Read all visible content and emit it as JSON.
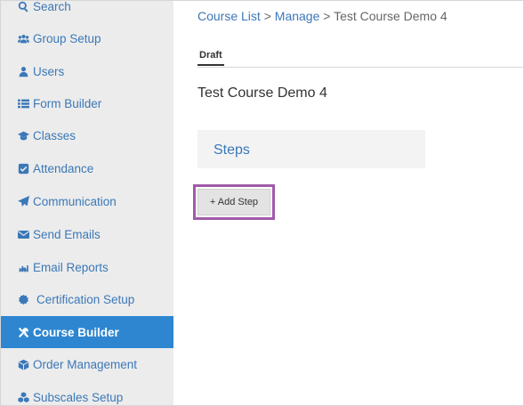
{
  "sidebar": {
    "items": [
      {
        "label": "Search",
        "icon": "search-icon"
      },
      {
        "label": "Group Setup",
        "icon": "group-icon"
      },
      {
        "label": "Users",
        "icon": "user-icon"
      },
      {
        "label": "Form Builder",
        "icon": "list-icon"
      },
      {
        "label": "Classes",
        "icon": "graduation-cap-icon"
      },
      {
        "label": "Attendance",
        "icon": "check-square-icon"
      },
      {
        "label": "Communication",
        "icon": "paper-plane-icon"
      },
      {
        "label": "Send Emails",
        "icon": "envelope-icon"
      },
      {
        "label": "Email Reports",
        "icon": "bar-chart-icon"
      },
      {
        "label": "Certification Setup",
        "icon": "certificate-icon"
      },
      {
        "label": "Course Builder",
        "icon": "tools-icon",
        "active": true
      },
      {
        "label": "Order Management",
        "icon": "cube-icon"
      },
      {
        "label": "Subscales Setup",
        "icon": "cubes-icon"
      }
    ]
  },
  "breadcrumb": {
    "course_list": "Course List",
    "sep1": " > ",
    "manage": "Manage",
    "sep2": " > ",
    "current": "Test Course Demo 4"
  },
  "tabs": {
    "draft": "Draft"
  },
  "main": {
    "title": "Test Course Demo 4",
    "steps_label": "Steps",
    "add_step_label": "+ Add Step"
  },
  "colors": {
    "accent": "#3b78b8",
    "active_bg": "#2e86d0",
    "sidebar_bg": "#ececec",
    "highlight": "#a05aa8"
  }
}
